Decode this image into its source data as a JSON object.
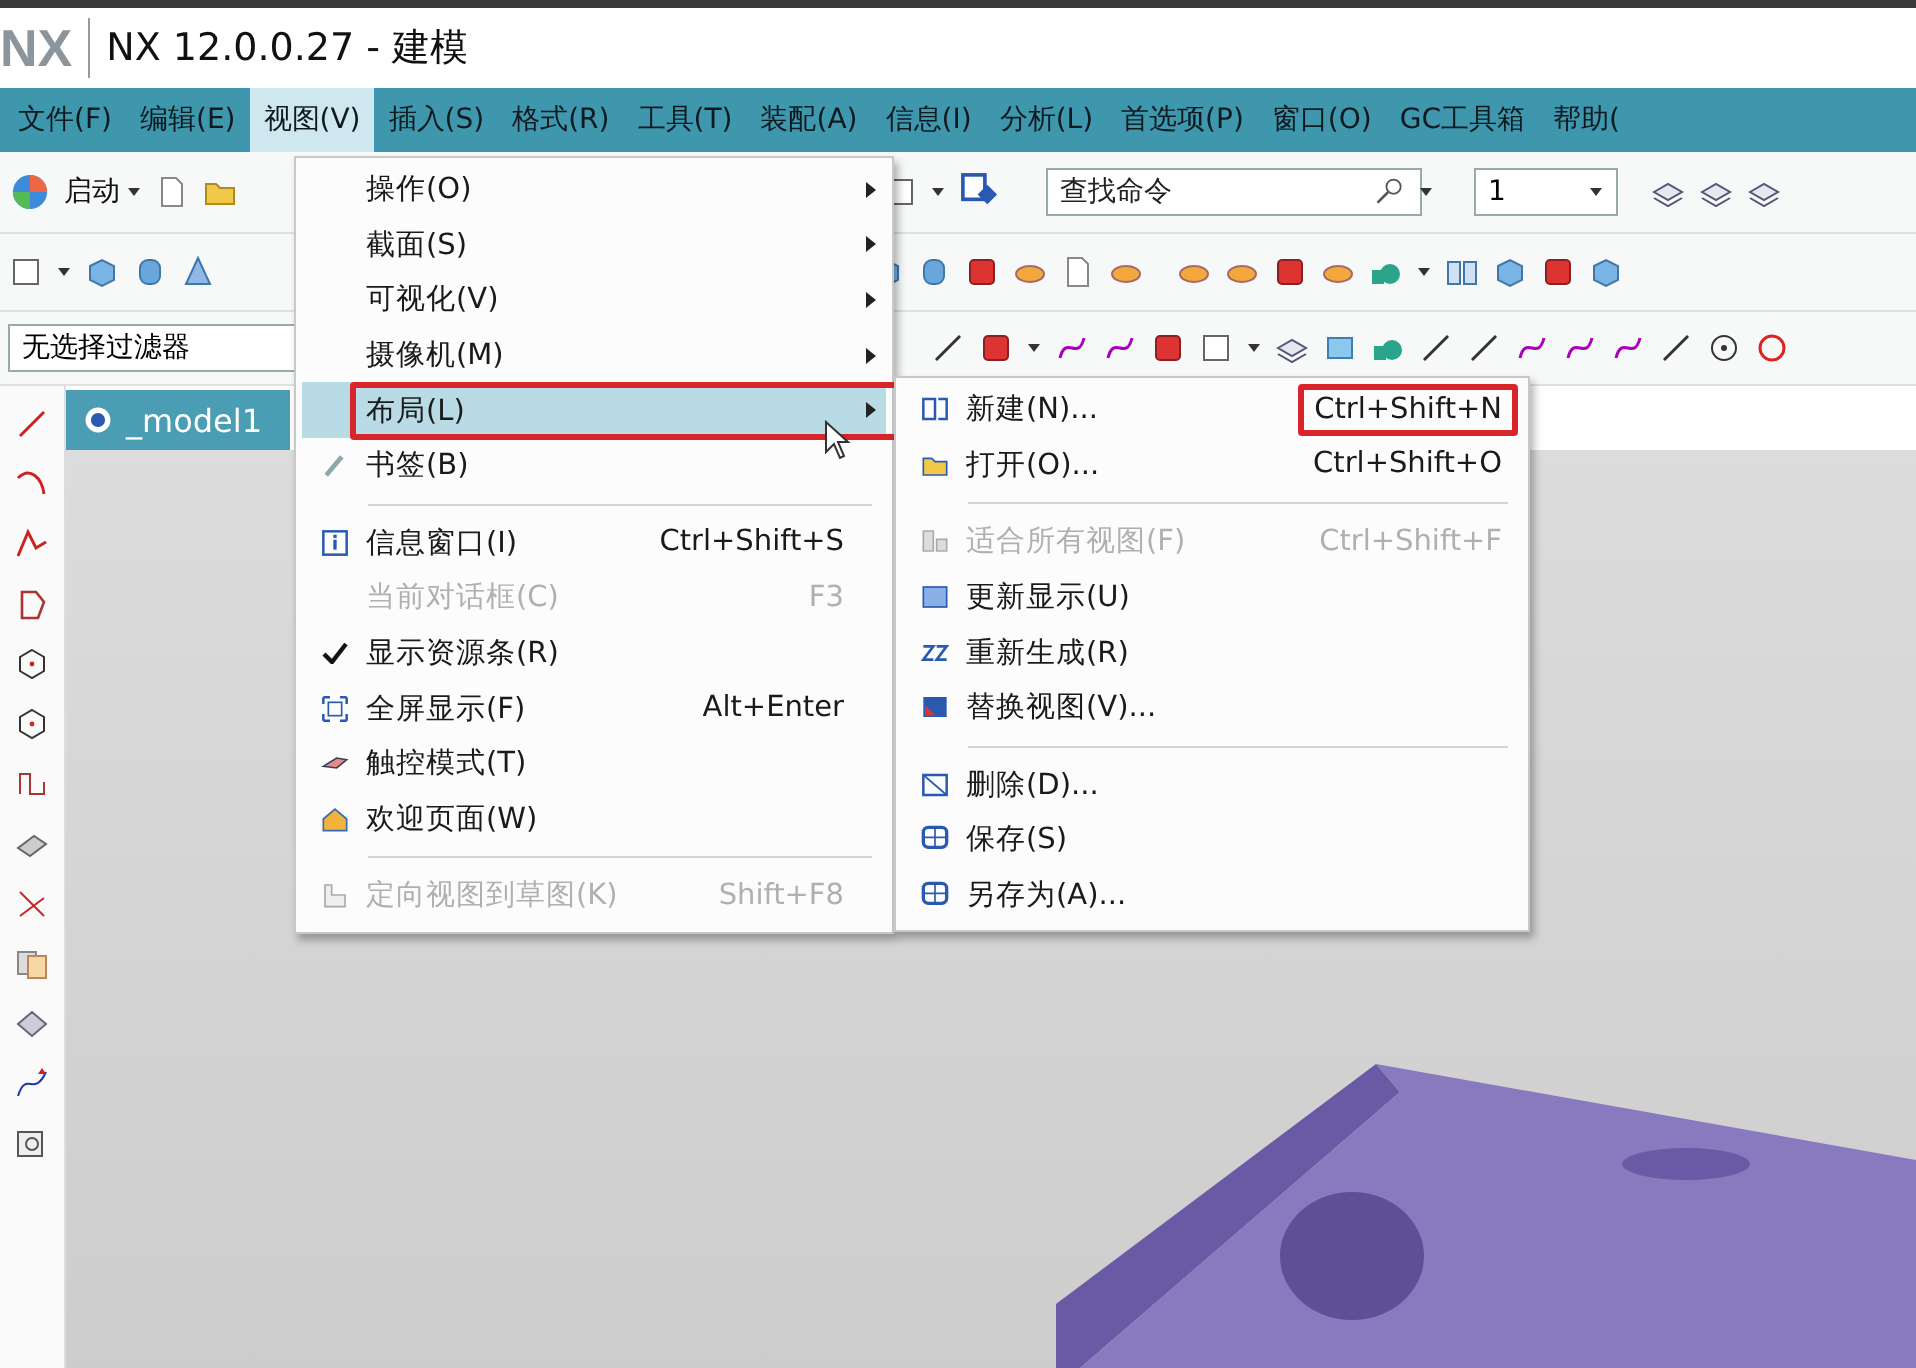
{
  "window": {
    "title": "NX 12.0.0.27 - 建模",
    "logo": "NX"
  },
  "menubar": [
    {
      "label": "文件(F)",
      "selected": false
    },
    {
      "label": "编辑(E)",
      "selected": false
    },
    {
      "label": "视图(V)",
      "selected": true
    },
    {
      "label": "插入(S)",
      "selected": false
    },
    {
      "label": "格式(R)",
      "selected": false
    },
    {
      "label": "工具(T)",
      "selected": false
    },
    {
      "label": "装配(A)",
      "selected": false
    },
    {
      "label": "信息(I)",
      "selected": false
    },
    {
      "label": "分析(L)",
      "selected": false
    },
    {
      "label": "首选项(P)",
      "selected": false
    },
    {
      "label": "窗口(O)",
      "selected": false
    },
    {
      "label": "GC工具箱",
      "selected": false
    },
    {
      "label": "帮助(",
      "selected": false
    }
  ],
  "toolbar": {
    "start_label": "启动",
    "search": {
      "placeholder": "查找命令"
    },
    "count_dropdown": {
      "value": "1"
    },
    "selection_filter": {
      "value": "无选择过滤器"
    }
  },
  "tab": {
    "label": "_model1"
  },
  "view_menu": [
    {
      "kind": "item",
      "label": "操作(O)",
      "has_submenu": true,
      "highlighted": false,
      "disabled": false,
      "checked": false
    },
    {
      "kind": "item",
      "label": "截面(S)",
      "has_submenu": true,
      "highlighted": false,
      "disabled": false,
      "checked": false
    },
    {
      "kind": "item",
      "label": "可视化(V)",
      "has_submenu": true,
      "highlighted": false,
      "disabled": false,
      "checked": false
    },
    {
      "kind": "item",
      "label": "摄像机(M)",
      "has_submenu": true,
      "highlighted": false,
      "disabled": false,
      "checked": false
    },
    {
      "kind": "item",
      "label": "布局(L)",
      "has_submenu": true,
      "highlighted": true,
      "disabled": false,
      "checked": false,
      "annotated": true
    },
    {
      "kind": "item",
      "label": "书签(B)",
      "has_submenu": false,
      "highlighted": false,
      "disabled": false,
      "checked": false
    },
    {
      "kind": "separator"
    },
    {
      "kind": "item",
      "label": "信息窗口(I)",
      "shortcut": "Ctrl+Shift+S",
      "has_submenu": false,
      "highlighted": false,
      "disabled": false,
      "checked": false
    },
    {
      "kind": "item",
      "label": "当前对话框(C)",
      "shortcut": "F3",
      "has_submenu": false,
      "highlighted": false,
      "disabled": true,
      "checked": false
    },
    {
      "kind": "item",
      "label": "显示资源条(R)",
      "has_submenu": false,
      "highlighted": false,
      "disabled": false,
      "checked": true
    },
    {
      "kind": "item",
      "label": "全屏显示(F)",
      "shortcut": "Alt+Enter",
      "has_submenu": false,
      "highlighted": false,
      "disabled": false,
      "checked": false
    },
    {
      "kind": "item",
      "label": "触控模式(T)",
      "has_submenu": false,
      "highlighted": false,
      "disabled": false,
      "checked": false
    },
    {
      "kind": "item",
      "label": "欢迎页面(W)",
      "has_submenu": false,
      "highlighted": false,
      "disabled": false,
      "checked": false
    },
    {
      "kind": "separator"
    },
    {
      "kind": "item",
      "label": "定向视图到草图(K)",
      "shortcut": "Shift+F8",
      "has_submenu": false,
      "highlighted": false,
      "disabled": true,
      "checked": false
    }
  ],
  "layout_submenu": [
    {
      "kind": "item",
      "label": "新建(N)...",
      "shortcut": "Ctrl+Shift+N",
      "disabled": false,
      "annotated": true
    },
    {
      "kind": "item",
      "label": "打开(O)...",
      "shortcut": "Ctrl+Shift+O",
      "disabled": false
    },
    {
      "kind": "separator"
    },
    {
      "kind": "item",
      "label": "适合所有视图(F)",
      "shortcut": "Ctrl+Shift+F",
      "disabled": true
    },
    {
      "kind": "item",
      "label": "更新显示(U)",
      "disabled": false
    },
    {
      "kind": "item",
      "label": "重新生成(R)",
      "disabled": false
    },
    {
      "kind": "item",
      "label": "替换视图(V)...",
      "disabled": false
    },
    {
      "kind": "separator"
    },
    {
      "kind": "item",
      "label": "删除(D)...",
      "disabled": false
    },
    {
      "kind": "item",
      "label": "保存(S)",
      "disabled": false
    },
    {
      "kind": "item",
      "label": "另存为(A)...",
      "disabled": false
    }
  ]
}
